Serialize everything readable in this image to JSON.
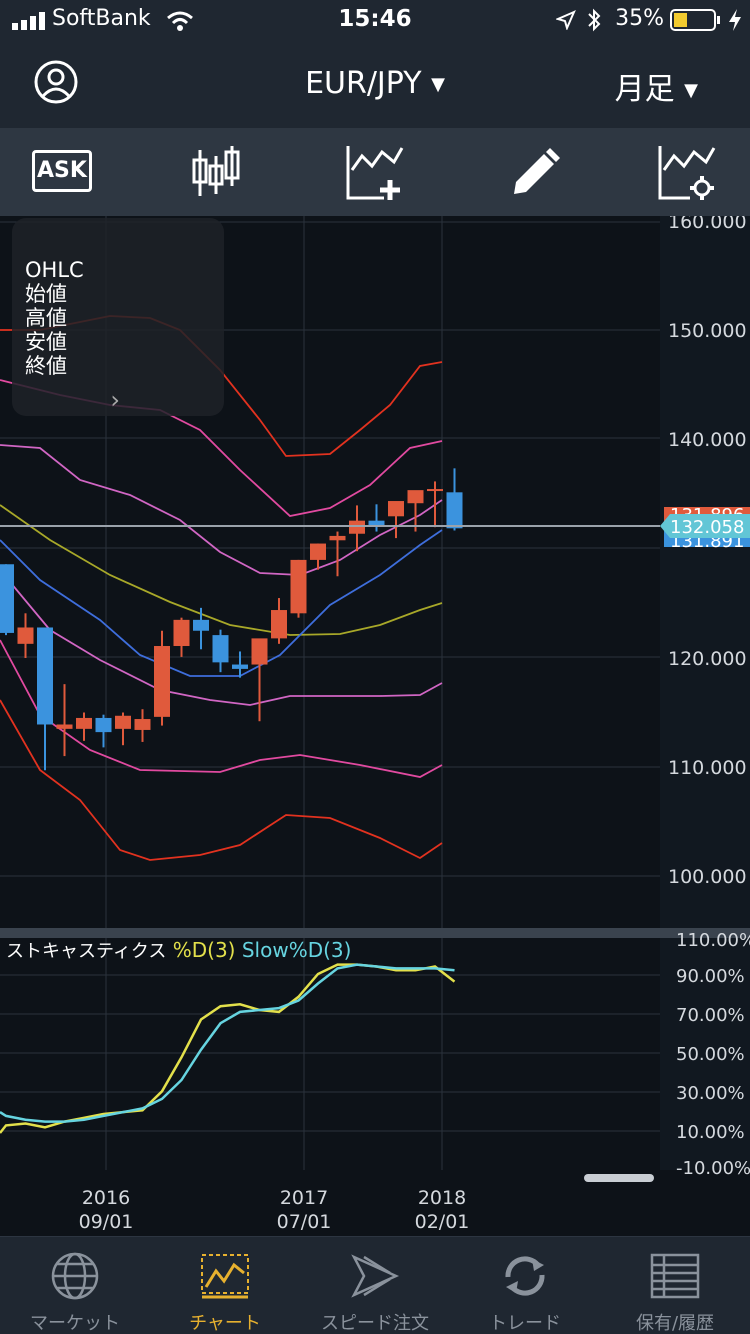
{
  "status_bar": {
    "carrier": "SoftBank",
    "time": "15:46",
    "battery_percent": "35%"
  },
  "header": {
    "pair": "EUR/JPY",
    "period": "月足"
  },
  "toolbar": {
    "ask_label": "ASK"
  },
  "ohlc_panel": {
    "title": "OHLC",
    "open": "始値",
    "high": "高値",
    "low": "安値",
    "close": "終値"
  },
  "price_axis": {
    "ticks": [
      "160.000",
      "150.000",
      "140.000",
      "120.000",
      "110.000",
      "100.000"
    ],
    "current_price": "132.058",
    "label_a": "131.896",
    "label_b": "131.891"
  },
  "stochastics": {
    "title": "ストキャスティクス",
    "d_label": "%D(3)",
    "slow_label": "Slow%D(3)",
    "ticks": [
      "110.00%",
      "90.00%",
      "70.00%",
      "50.00%",
      "30.00%",
      "10.00%",
      "-10.00%"
    ]
  },
  "x_axis": {
    "labels": [
      {
        "year": "2016",
        "date": "09/01"
      },
      {
        "year": "2017",
        "date": "07/01"
      },
      {
        "year": "2018",
        "date": "02/01"
      }
    ]
  },
  "tabs": [
    {
      "label": "マーケット",
      "icon": "globe-icon"
    },
    {
      "label": "チャート",
      "icon": "chart-icon"
    },
    {
      "label": "スピード注文",
      "icon": "speed-icon"
    },
    {
      "label": "トレード",
      "icon": "trade-icon"
    },
    {
      "label": "保有/履歴",
      "icon": "history-icon"
    }
  ],
  "colors": {
    "bull": "#e05a3c",
    "bear": "#3b93de",
    "bb3": "#e2321f",
    "bb2": "#e14aa0",
    "bb1": "#d166c4",
    "mid": "#a8a829",
    "ma": "#3e6edc",
    "stoch_d": "#e3e04b",
    "stoch_slow": "#66d4e0",
    "accent": "#e7b12f"
  }
}
